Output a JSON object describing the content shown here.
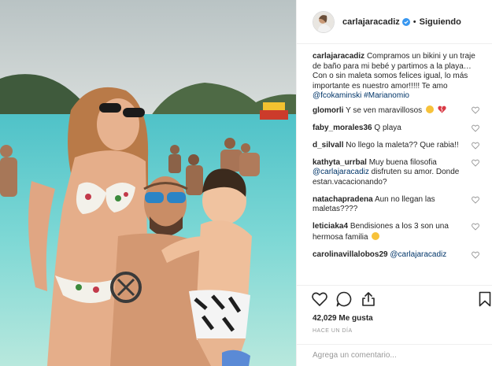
{
  "post": {
    "username": "carlajaracadiz",
    "follow_status": "Siguiendo",
    "dot": "•",
    "caption": {
      "username": "carlajaracadiz",
      "text": "Compramos un bikini y un traje de baño para mi bebé y partimos a la playa… Con o sin maleta somos felices igual, lo más importante es nuestro amor!!!!! Te amo ",
      "mention": "@fcokaminski",
      "hashtag": "#Marianomio"
    }
  },
  "comments": [
    {
      "username": "glomorli",
      "text": "Y se ven maravillosos",
      "emojis": [
        "smile-emoji",
        "broken-heart-emoji"
      ]
    },
    {
      "username": "faby_morales36",
      "text": "Q playa"
    },
    {
      "username": "d_silvall",
      "text": "No llego la maleta?? Que rabia!!"
    },
    {
      "username": "kathyta_urrbal",
      "text": "Muy buena filosofia",
      "mention": "@carlajaracadiz",
      "text2": "disfruten su amor. Donde estan.vacacionando?"
    },
    {
      "username": "natachapradena",
      "text": "Aun no llegan las maletas????"
    },
    {
      "username": "leticiaka4",
      "text": "Bendisiones a los 3 son una hermosa familia",
      "emojis": [
        "smile-emoji"
      ]
    },
    {
      "username": "carolinavillalobos29",
      "mention": "@carlajaracadiz"
    }
  ],
  "likes": "42,029 Me gusta",
  "time": "HACE UN DÍA",
  "add_comment": {
    "placeholder": "Agrega un comentario..."
  },
  "icons": [
    "heart-icon",
    "comment-icon",
    "share-icon",
    "bookmark-icon",
    "verified-icon"
  ],
  "colors": {
    "mention": "#003569",
    "verified": "#3897f0",
    "muted": "#999999",
    "border": "#efefef"
  }
}
